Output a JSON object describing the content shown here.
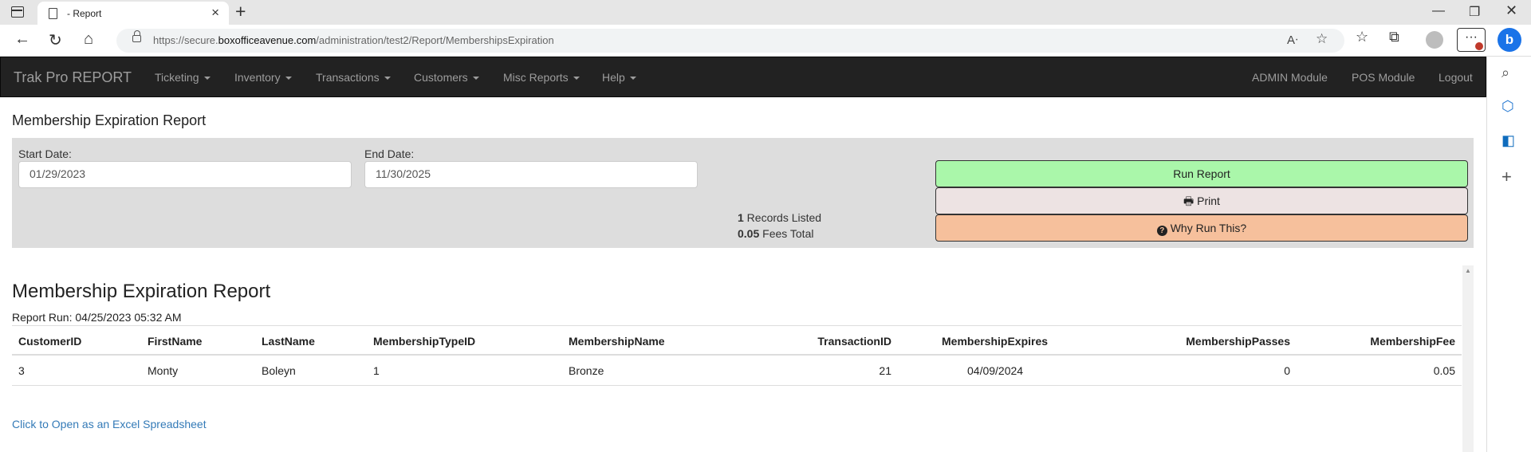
{
  "browser": {
    "tab_title": "- Report",
    "url_prefix": "https://secure.",
    "url_host": "boxofficeavenue.com",
    "url_path": "/administration/test2/Report/MembershipsExpiration"
  },
  "navbar": {
    "brand": "Trak Pro REPORT",
    "menus": [
      "Ticketing",
      "Inventory",
      "Transactions",
      "Customers",
      "Misc Reports",
      "Help"
    ],
    "right_links": [
      "ADMIN Module",
      "POS Module",
      "Logout"
    ]
  },
  "page": {
    "title": "Membership Expiration Report"
  },
  "filters": {
    "start_label": "Start Date:",
    "start_value": "01/29/2023",
    "end_label": "End Date:",
    "end_value": "11/30/2025"
  },
  "summary": {
    "records_count": "1",
    "records_label": " Records Listed",
    "fees_total": "0.05",
    "fees_label": " Fees Total"
  },
  "buttons": {
    "run": "Run Report",
    "print": "Print",
    "why": "Why Run This?"
  },
  "report": {
    "heading": "Membership Expiration Report",
    "run_info": "Report Run: 04/25/2023 05:32 AM",
    "columns": [
      "CustomerID",
      "FirstName",
      "LastName",
      "MembershipTypeID",
      "MembershipName",
      "TransactionID",
      "MembershipExpires",
      "MembershipPasses",
      "MembershipFee"
    ],
    "rows": [
      [
        "3",
        "Monty",
        "Boleyn",
        "1",
        "Bronze",
        "21",
        "04/09/2024",
        "0",
        "0.05"
      ]
    ]
  },
  "excel_link": "Click to Open as an Excel Spreadsheet"
}
